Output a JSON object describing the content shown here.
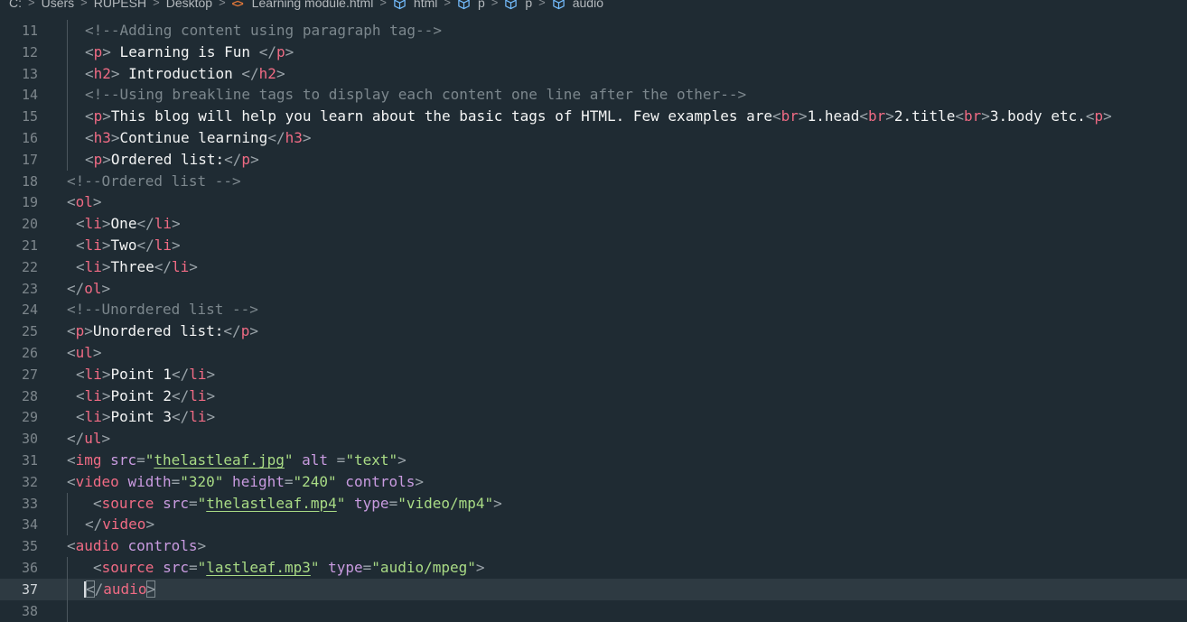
{
  "breadcrumb": {
    "items": [
      {
        "label": "C:",
        "icon": null
      },
      {
        "label": "Users",
        "icon": null
      },
      {
        "label": "RUPESH",
        "icon": null
      },
      {
        "label": "Desktop",
        "icon": null
      },
      {
        "label": "Learning module.html",
        "icon": "html-file-icon"
      },
      {
        "label": "html",
        "icon": "cube-icon"
      },
      {
        "label": "p",
        "icon": "cube-icon"
      },
      {
        "label": "p",
        "icon": "cube-icon"
      },
      {
        "label": "audio",
        "icon": "cube-icon"
      }
    ],
    "separator": ">"
  },
  "editor": {
    "current_line": "37",
    "lines": [
      {
        "num": "11",
        "indent": 20,
        "guides": [
          74
        ],
        "tokens": [
          {
            "t": "<!--Adding content using paragraph tag-->",
            "c": "cmt"
          }
        ]
      },
      {
        "num": "12",
        "indent": 20,
        "guides": [
          74
        ],
        "tokens": [
          {
            "t": "<",
            "c": "punc"
          },
          {
            "t": "p",
            "c": "tag"
          },
          {
            "t": ">",
            "c": "punc"
          },
          {
            "t": " Learning is Fun ",
            "c": "txt"
          },
          {
            "t": "</",
            "c": "punc"
          },
          {
            "t": "p",
            "c": "tag"
          },
          {
            "t": ">",
            "c": "punc"
          }
        ]
      },
      {
        "num": "13",
        "indent": 20,
        "guides": [
          74
        ],
        "tokens": [
          {
            "t": "<",
            "c": "punc"
          },
          {
            "t": "h2",
            "c": "tag"
          },
          {
            "t": ">",
            "c": "punc"
          },
          {
            "t": " Introduction ",
            "c": "txt"
          },
          {
            "t": "</",
            "c": "punc"
          },
          {
            "t": "h2",
            "c": "tag"
          },
          {
            "t": ">",
            "c": "punc"
          }
        ]
      },
      {
        "num": "14",
        "indent": 20,
        "guides": [
          74
        ],
        "tokens": [
          {
            "t": "<!--Using breakline tags to display each content one line after the other-->",
            "c": "cmt"
          }
        ]
      },
      {
        "num": "15",
        "indent": 20,
        "guides": [
          74
        ],
        "tokens": [
          {
            "t": "<",
            "c": "punc"
          },
          {
            "t": "p",
            "c": "tag"
          },
          {
            "t": ">",
            "c": "punc"
          },
          {
            "t": "This blog will help you learn about the basic tags of HTML. Few examples are",
            "c": "txt"
          },
          {
            "t": "<",
            "c": "punc"
          },
          {
            "t": "br",
            "c": "tag"
          },
          {
            "t": ">",
            "c": "punc"
          },
          {
            "t": "1.head",
            "c": "txt"
          },
          {
            "t": "<",
            "c": "punc"
          },
          {
            "t": "br",
            "c": "tag"
          },
          {
            "t": ">",
            "c": "punc"
          },
          {
            "t": "2.title",
            "c": "txt"
          },
          {
            "t": "<",
            "c": "punc"
          },
          {
            "t": "br",
            "c": "tag"
          },
          {
            "t": ">",
            "c": "punc"
          },
          {
            "t": "3.body etc.",
            "c": "txt"
          },
          {
            "t": "<",
            "c": "punc"
          },
          {
            "t": "p",
            "c": "tag"
          },
          {
            "t": ">",
            "c": "punc"
          }
        ]
      },
      {
        "num": "16",
        "indent": 20,
        "guides": [
          74
        ],
        "tokens": [
          {
            "t": "<",
            "c": "punc"
          },
          {
            "t": "h3",
            "c": "tag"
          },
          {
            "t": ">",
            "c": "punc"
          },
          {
            "t": "Continue learning",
            "c": "txt"
          },
          {
            "t": "</",
            "c": "punc"
          },
          {
            "t": "h3",
            "c": "tag"
          },
          {
            "t": ">",
            "c": "punc"
          }
        ]
      },
      {
        "num": "17",
        "indent": 20,
        "guides": [
          74
        ],
        "tokens": [
          {
            "t": "<",
            "c": "punc"
          },
          {
            "t": "p",
            "c": "tag"
          },
          {
            "t": ">",
            "c": "punc"
          },
          {
            "t": "Ordered list:",
            "c": "txt"
          },
          {
            "t": "</",
            "c": "punc"
          },
          {
            "t": "p",
            "c": "tag"
          },
          {
            "t": ">",
            "c": "punc"
          }
        ]
      },
      {
        "num": "18",
        "indent": 0,
        "guides": [],
        "tokens": [
          {
            "t": "<!--Ordered list -->",
            "c": "cmt"
          }
        ]
      },
      {
        "num": "19",
        "indent": 0,
        "guides": [],
        "tokens": [
          {
            "t": "<",
            "c": "punc"
          },
          {
            "t": "ol",
            "c": "tag"
          },
          {
            "t": ">",
            "c": "punc"
          }
        ]
      },
      {
        "num": "20",
        "indent": 10,
        "guides": [],
        "tokens": [
          {
            "t": "<",
            "c": "punc"
          },
          {
            "t": "li",
            "c": "tag"
          },
          {
            "t": ">",
            "c": "punc"
          },
          {
            "t": "One",
            "c": "txt"
          },
          {
            "t": "</",
            "c": "punc"
          },
          {
            "t": "li",
            "c": "tag"
          },
          {
            "t": ">",
            "c": "punc"
          }
        ]
      },
      {
        "num": "21",
        "indent": 10,
        "guides": [],
        "tokens": [
          {
            "t": "<",
            "c": "punc"
          },
          {
            "t": "li",
            "c": "tag"
          },
          {
            "t": ">",
            "c": "punc"
          },
          {
            "t": "Two",
            "c": "txt"
          },
          {
            "t": "</",
            "c": "punc"
          },
          {
            "t": "li",
            "c": "tag"
          },
          {
            "t": ">",
            "c": "punc"
          }
        ]
      },
      {
        "num": "22",
        "indent": 10,
        "guides": [],
        "tokens": [
          {
            "t": "<",
            "c": "punc"
          },
          {
            "t": "li",
            "c": "tag"
          },
          {
            "t": ">",
            "c": "punc"
          },
          {
            "t": "Three",
            "c": "txt"
          },
          {
            "t": "</",
            "c": "punc"
          },
          {
            "t": "li",
            "c": "tag"
          },
          {
            "t": ">",
            "c": "punc"
          }
        ]
      },
      {
        "num": "23",
        "indent": 0,
        "guides": [],
        "tokens": [
          {
            "t": "</",
            "c": "punc"
          },
          {
            "t": "ol",
            "c": "tag"
          },
          {
            "t": ">",
            "c": "punc"
          }
        ]
      },
      {
        "num": "24",
        "indent": 0,
        "guides": [],
        "tokens": [
          {
            "t": "<!--Unordered list -->",
            "c": "cmt"
          }
        ]
      },
      {
        "num": "25",
        "indent": 0,
        "guides": [],
        "tokens": [
          {
            "t": "<",
            "c": "punc"
          },
          {
            "t": "p",
            "c": "tag"
          },
          {
            "t": ">",
            "c": "punc"
          },
          {
            "t": "Unordered list:",
            "c": "txt"
          },
          {
            "t": "</",
            "c": "punc"
          },
          {
            "t": "p",
            "c": "tag"
          },
          {
            "t": ">",
            "c": "punc"
          }
        ]
      },
      {
        "num": "26",
        "indent": 0,
        "guides": [],
        "tokens": [
          {
            "t": "<",
            "c": "punc"
          },
          {
            "t": "ul",
            "c": "tag"
          },
          {
            "t": ">",
            "c": "punc"
          }
        ]
      },
      {
        "num": "27",
        "indent": 10,
        "guides": [],
        "tokens": [
          {
            "t": "<",
            "c": "punc"
          },
          {
            "t": "li",
            "c": "tag"
          },
          {
            "t": ">",
            "c": "punc"
          },
          {
            "t": "Point 1",
            "c": "txt"
          },
          {
            "t": "</",
            "c": "punc"
          },
          {
            "t": "li",
            "c": "tag"
          },
          {
            "t": ">",
            "c": "punc"
          }
        ]
      },
      {
        "num": "28",
        "indent": 10,
        "guides": [],
        "tokens": [
          {
            "t": "<",
            "c": "punc"
          },
          {
            "t": "li",
            "c": "tag"
          },
          {
            "t": ">",
            "c": "punc"
          },
          {
            "t": "Point 2",
            "c": "txt"
          },
          {
            "t": "</",
            "c": "punc"
          },
          {
            "t": "li",
            "c": "tag"
          },
          {
            "t": ">",
            "c": "punc"
          }
        ]
      },
      {
        "num": "29",
        "indent": 10,
        "guides": [],
        "tokens": [
          {
            "t": "<",
            "c": "punc"
          },
          {
            "t": "li",
            "c": "tag"
          },
          {
            "t": ">",
            "c": "punc"
          },
          {
            "t": "Point 3",
            "c": "txt"
          },
          {
            "t": "</",
            "c": "punc"
          },
          {
            "t": "li",
            "c": "tag"
          },
          {
            "t": ">",
            "c": "punc"
          }
        ]
      },
      {
        "num": "30",
        "indent": 0,
        "guides": [],
        "tokens": [
          {
            "t": "</",
            "c": "punc"
          },
          {
            "t": "ul",
            "c": "tag"
          },
          {
            "t": ">",
            "c": "punc"
          }
        ]
      },
      {
        "num": "31",
        "indent": 0,
        "guides": [],
        "tokens": [
          {
            "t": "<",
            "c": "punc"
          },
          {
            "t": "img",
            "c": "tag"
          },
          {
            "t": " src",
            "c": "attr"
          },
          {
            "t": "=",
            "c": "punc"
          },
          {
            "t": "\"",
            "c": "str"
          },
          {
            "t": "thelastleaf.jpg",
            "c": "str link"
          },
          {
            "t": "\"",
            "c": "str"
          },
          {
            "t": " alt ",
            "c": "attr"
          },
          {
            "t": "=",
            "c": "punc"
          },
          {
            "t": "\"text\"",
            "c": "str"
          },
          {
            "t": ">",
            "c": "punc"
          }
        ]
      },
      {
        "num": "32",
        "indent": 0,
        "guides": [],
        "tokens": [
          {
            "t": "<",
            "c": "punc"
          },
          {
            "t": "video",
            "c": "tag"
          },
          {
            "t": " width",
            "c": "attr"
          },
          {
            "t": "=",
            "c": "punc"
          },
          {
            "t": "\"320\"",
            "c": "str"
          },
          {
            "t": " height",
            "c": "attr"
          },
          {
            "t": "=",
            "c": "punc"
          },
          {
            "t": "\"240\"",
            "c": "str"
          },
          {
            "t": " controls",
            "c": "attr"
          },
          {
            "t": ">",
            "c": "punc"
          }
        ]
      },
      {
        "num": "33",
        "indent": 29,
        "guides": [
          74
        ],
        "tokens": [
          {
            "t": "<",
            "c": "punc"
          },
          {
            "t": "source",
            "c": "tag"
          },
          {
            "t": " src",
            "c": "attr"
          },
          {
            "t": "=",
            "c": "punc"
          },
          {
            "t": "\"",
            "c": "str"
          },
          {
            "t": "thelastleaf.mp4",
            "c": "str link"
          },
          {
            "t": "\"",
            "c": "str"
          },
          {
            "t": " type",
            "c": "attr"
          },
          {
            "t": "=",
            "c": "punc"
          },
          {
            "t": "\"video/mp4\"",
            "c": "str"
          },
          {
            "t": ">",
            "c": "punc"
          }
        ]
      },
      {
        "num": "34",
        "indent": 20,
        "guides": [
          74
        ],
        "tokens": [
          {
            "t": "</",
            "c": "punc"
          },
          {
            "t": "video",
            "c": "tag"
          },
          {
            "t": ">",
            "c": "punc"
          }
        ]
      },
      {
        "num": "35",
        "indent": 0,
        "guides": [],
        "tokens": [
          {
            "t": "<",
            "c": "punc"
          },
          {
            "t": "audio",
            "c": "tag"
          },
          {
            "t": " controls",
            "c": "attr"
          },
          {
            "t": ">",
            "c": "punc"
          }
        ]
      },
      {
        "num": "36",
        "indent": 29,
        "guides": [
          74
        ],
        "tokens": [
          {
            "t": "<",
            "c": "punc"
          },
          {
            "t": "source",
            "c": "tag"
          },
          {
            "t": " src",
            "c": "attr"
          },
          {
            "t": "=",
            "c": "punc"
          },
          {
            "t": "\"",
            "c": "str"
          },
          {
            "t": "lastleaf.mp3",
            "c": "str link"
          },
          {
            "t": "\"",
            "c": "str"
          },
          {
            "t": " type",
            "c": "attr"
          },
          {
            "t": "=",
            "c": "punc"
          },
          {
            "t": "\"audio/mpeg\"",
            "c": "str"
          },
          {
            "t": ">",
            "c": "punc"
          }
        ]
      },
      {
        "num": "37",
        "indent": 20,
        "guides": [
          74
        ],
        "tokens": [
          {
            "t": "<",
            "c": "punc bracket-match cursor-before"
          },
          {
            "t": "/",
            "c": "punc"
          },
          {
            "t": "audio",
            "c": "tag"
          },
          {
            "t": ">",
            "c": "punc bracket-match"
          }
        ]
      },
      {
        "num": "38",
        "indent": 0,
        "guides": [
          74
        ],
        "tokens": []
      }
    ]
  }
}
